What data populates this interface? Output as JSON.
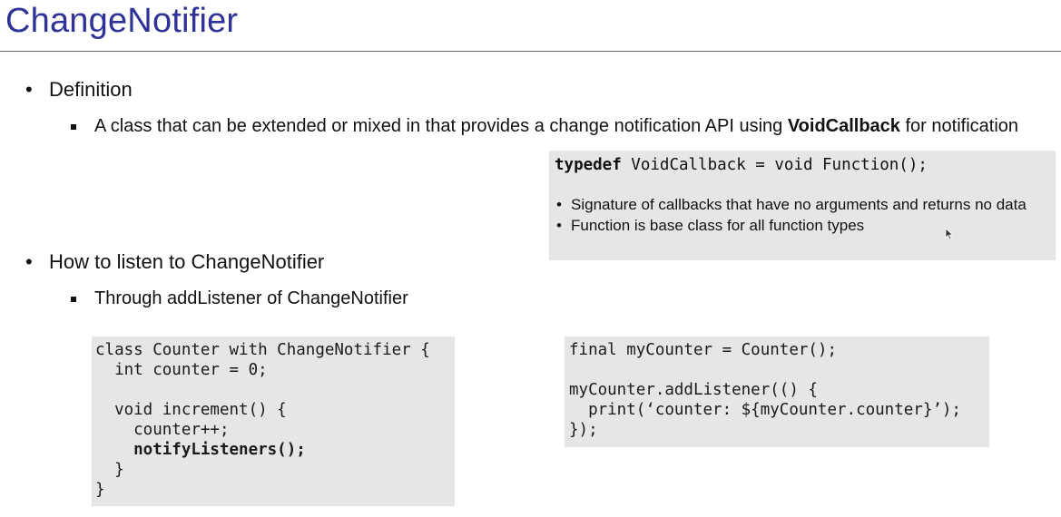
{
  "slide": {
    "title": "ChangeNotifier",
    "definition": {
      "heading": "Definition",
      "item_pre": "A class that can be extended or mixed in that provides a change notification API using ",
      "item_bold": "VoidCallback",
      "item_post": " for notification"
    },
    "listen": {
      "heading": "How to listen to ChangeNotifier",
      "item": "Through addListener of ChangeNotifier"
    },
    "info_box": {
      "code_keyword": "typedef",
      "code_rest": " VoidCallback = void Function();",
      "bullets": [
        "Signature of callbacks that have no arguments and returns no data",
        "Function is base class for all function types"
      ]
    },
    "code_left": {
      "line1": "class Counter with ChangeNotifier {",
      "line2": "  int counter = 0;",
      "line3": "",
      "line4": "  void increment() {",
      "line5": "    counter++;",
      "line6": "    notifyListeners();",
      "line7": "  }",
      "line8": "}"
    },
    "code_right": {
      "line1": "final myCounter = Counter();",
      "line2": "",
      "line3": "myCounter.addListener(() {",
      "line4": "  print(‘counter: ${myCounter.counter}’);",
      "line5": "});"
    },
    "bullet_glyph": "•",
    "cursor_icon": "mouse-pointer-icon"
  }
}
